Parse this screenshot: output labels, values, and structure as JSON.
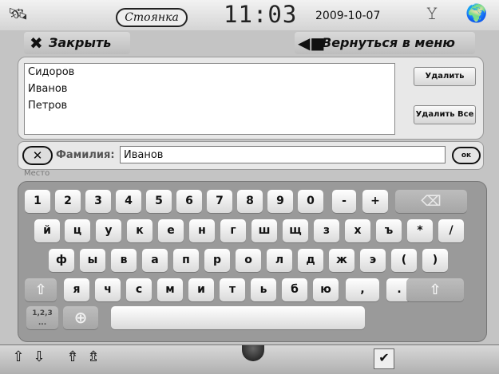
{
  "status": {
    "gps_icon": "satellite-icon",
    "mode": "Стоянка",
    "clock": "11:03",
    "date": "2009-10-07",
    "antenna_icon": "antenna-icon",
    "globe_icon": "globe-icon"
  },
  "header": {
    "close_label": "Закрыть",
    "close_icon": "close-x-icon",
    "menu_label": "Вернуться в меню",
    "menu_icon": "arrow-left-icon"
  },
  "list": {
    "items": [
      "Сидоров",
      "Иванов",
      "Петров"
    ],
    "delete_label": "Удалить",
    "delete_all_label": "Удалить Все"
  },
  "input": {
    "label": "Фамилия:",
    "value": "Иванов",
    "clear_label": "✕",
    "ok_label": "ок",
    "hint": "Место"
  },
  "keyboard": {
    "row1": [
      "1",
      "2",
      "3",
      "4",
      "5",
      "6",
      "7",
      "8",
      "9",
      "0",
      "-",
      "+"
    ],
    "row2": [
      "й",
      "ц",
      "у",
      "к",
      "е",
      "н",
      "г",
      "ш",
      "щ",
      "з",
      "х",
      "ъ",
      "*",
      "/"
    ],
    "row3": [
      "ф",
      "ы",
      "в",
      "а",
      "п",
      "р",
      "о",
      "л",
      "д",
      "ж",
      "э",
      "(",
      ")"
    ],
    "row4": [
      "я",
      "ч",
      "с",
      "м",
      "и",
      "т",
      "ь",
      "б",
      "ю",
      ",",
      "."
    ],
    "numeric_label": "1,2,3\n...",
    "backspace_icon": "backspace-icon",
    "shift_icon": "shift-arrow-icon",
    "language_icon": "globe-icon"
  },
  "bottom": {
    "icons": [
      "arrow-up-icon",
      "arrow-down-icon",
      "page-up-icon",
      "page-down-icon",
      "hemisphere-icon",
      "checkbox-icon"
    ]
  }
}
